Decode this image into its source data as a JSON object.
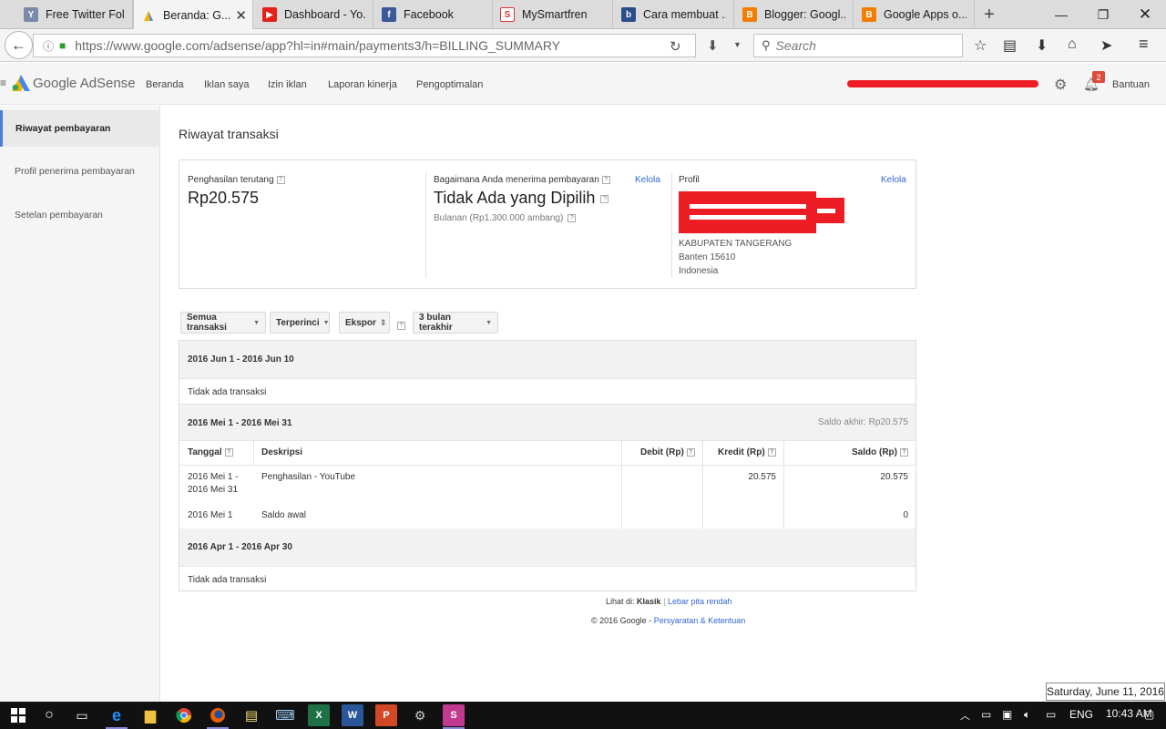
{
  "browser": {
    "tabs": [
      {
        "label": "Free Twitter Fol...",
        "icon": "Y"
      },
      {
        "label": "Beranda: G...",
        "icon": "adsense"
      },
      {
        "label": "Dashboard - Yo...",
        "icon": "youtube"
      },
      {
        "label": "Facebook",
        "icon": "f"
      },
      {
        "label": "MySmartfren",
        "icon": "smartfren"
      },
      {
        "label": "Cara membuat ...",
        "icon": "blog"
      },
      {
        "label": "Blogger: Googl...",
        "icon": "blogger"
      },
      {
        "label": "Google Apps o...",
        "icon": "blogger"
      }
    ],
    "url": "https://www.google.com/adsense/app?hl=in#main/payments3/h=BILLING_SUMMARY",
    "search_placeholder": "Search"
  },
  "adsense": {
    "logo": "Google AdSense",
    "nav": [
      "Beranda",
      "Iklan saya",
      "Izin iklan",
      "Laporan kinerja",
      "Pengoptimalan"
    ],
    "notifications": "2",
    "help": "Bantuan"
  },
  "sidebar": {
    "items": [
      "Riwayat pembayaran",
      "Profil penerima pembayaran",
      "Setelan pembayaran"
    ]
  },
  "page": {
    "title": "Riwayat transaksi",
    "earnings_label": "Penghasilan terutang",
    "earnings_value": "Rp20.575",
    "payment_label": "Bagaimana Anda menerima pembayaran",
    "manage": "Kelola",
    "payment_value": "Tidak Ada yang Dipilih",
    "payment_sub": "Bulanan (Rp1.300.000 ambang)",
    "profile_label": "Profil",
    "address": [
      "KABUPATEN TANGERANG",
      "Banten 15610",
      "Indonesia"
    ]
  },
  "filters": {
    "type": "Semua transaksi",
    "detail": "Terperinci",
    "export": "Ekspor",
    "range": "3 bulan terakhir"
  },
  "transactions": {
    "periods": [
      {
        "range": "2016 Jun 1 - 2016 Jun 10",
        "empty": "Tidak ada transaksi"
      },
      {
        "range": "2016 Mei 1 - 2016 Mei 31",
        "closing": "Saldo akhir: Rp20.575"
      },
      {
        "range": "2016 Apr 1 - 2016 Apr 30",
        "empty": "Tidak ada transaksi"
      }
    ],
    "columns": [
      "Tanggal",
      "Deskripsi",
      "Debit (Rp)",
      "Kredit (Rp)",
      "Saldo (Rp)"
    ],
    "rows": [
      {
        "date1": "2016 Mei 1 -",
        "date2": "2016 Mei 31",
        "desc": "Penghasilan - YouTube",
        "debit": "",
        "credit": "20.575",
        "balance": "20.575"
      },
      {
        "date1": "2016 Mei 1",
        "date2": "",
        "desc": "Saldo awal",
        "debit": "",
        "credit": "",
        "balance": "0"
      }
    ]
  },
  "footer": {
    "view_prefix": "Lihat di:",
    "view_classic": "Klasik",
    "view_sep": "|",
    "view_low": "Lebar pita rendah",
    "copyright": "© 2016 Google -",
    "terms": "Persyaratan & Ketentuan"
  },
  "system": {
    "date_tooltip": "Saturday, June 11, 2016",
    "lang": "ENG",
    "time": "10:43 AM"
  }
}
